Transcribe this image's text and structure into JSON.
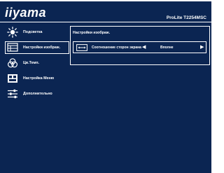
{
  "header": {
    "brand": "iiyama",
    "model": "ProLite T2254MSC"
  },
  "menu": {
    "items": [
      {
        "label": "Подсветка",
        "icon": "brightness-icon",
        "active": false
      },
      {
        "label": "Настройки изображ.",
        "icon": "screen-icon",
        "active": true
      },
      {
        "label": "Цв.Темп.",
        "icon": "color-temp-icon",
        "active": false
      },
      {
        "label": "Настройка Меню",
        "icon": "menu-settings-icon",
        "active": false
      },
      {
        "label": "Дополнительно",
        "icon": "sliders-icon",
        "active": false
      }
    ]
  },
  "content": {
    "title": "Настройки изображ.",
    "setting": {
      "label": "Соотношение сторон экрана",
      "value": "Вполне",
      "icon": "aspect-ratio-icon",
      "left_arrow": "◀",
      "right_arrow": "▶"
    }
  },
  "colors": {
    "background": "#0b2552",
    "text": "#ffffff"
  }
}
